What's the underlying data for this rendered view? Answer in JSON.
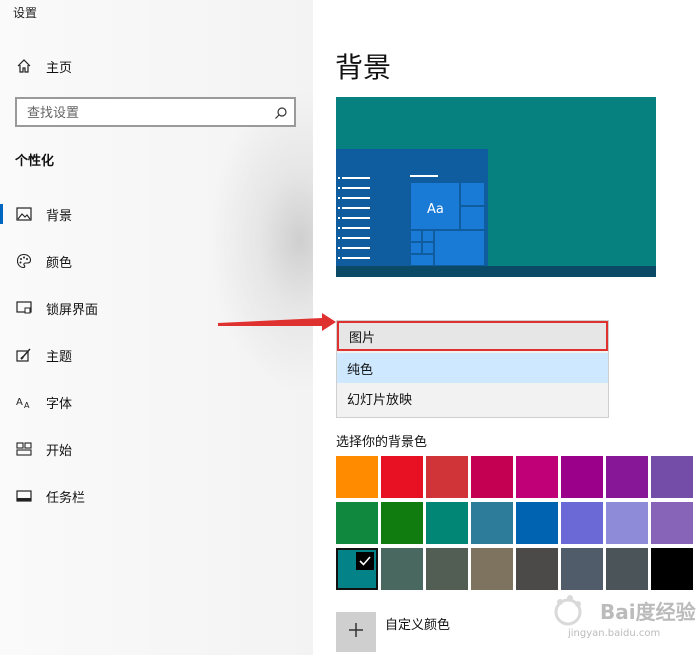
{
  "window": {
    "title": "设置"
  },
  "sidebar": {
    "home": "主页",
    "search_placeholder": "查找设置",
    "section": "个性化",
    "items": [
      {
        "label": "背景",
        "icon": "picture-icon",
        "active": true
      },
      {
        "label": "颜色",
        "icon": "palette-icon"
      },
      {
        "label": "锁屏界面",
        "icon": "lock-screen-icon"
      },
      {
        "label": "主题",
        "icon": "theme-icon"
      },
      {
        "label": "字体",
        "icon": "font-icon"
      },
      {
        "label": "开始",
        "icon": "start-icon"
      },
      {
        "label": "任务栏",
        "icon": "taskbar-icon"
      }
    ]
  },
  "main": {
    "title": "背景",
    "preview": {
      "tile_text": "Aa",
      "bg_color": "#078080"
    },
    "dropdown": {
      "options": [
        "图片",
        "纯色",
        "幻灯片放映"
      ],
      "selected": "纯色",
      "highlighted": "图片"
    },
    "color_label": "选择你的背景色",
    "colors": [
      [
        "#ff8c00",
        "#e81123",
        "#d13438",
        "#c30052",
        "#bf0077",
        "#9a0089",
        "#881798",
        "#744da9"
      ],
      [
        "#10893e",
        "#107c10",
        "#018574",
        "#2d7d9a",
        "#0063b1",
        "#6b69d6",
        "#8e8cd8",
        "#8764b8"
      ],
      [
        "#038387",
        "#486860",
        "#525e54",
        "#7e735f",
        "#4c4a48",
        "#515c6b",
        "#4a5459",
        "#000000"
      ]
    ],
    "selected_color": "#038387",
    "custom_label": "自定义颜色"
  },
  "watermark": {
    "text": "Bai度经验",
    "sub": "jingyan.baidu.com"
  }
}
